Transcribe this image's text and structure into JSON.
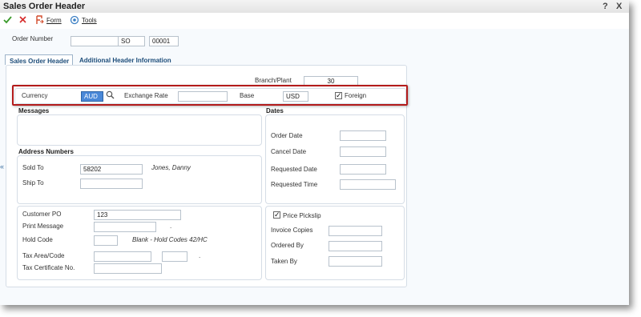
{
  "window": {
    "title": "Sales Order Header",
    "help": "?",
    "close": "X"
  },
  "toolbar": {
    "form_label": "Form",
    "tools_label": "Tools"
  },
  "order": {
    "label": "Order Number",
    "number": "",
    "type": "SO",
    "company": "00001"
  },
  "tabs": [
    "Sales Order Header",
    "Additional Header Information"
  ],
  "branch": {
    "label": "Branch/Plant",
    "value": "30"
  },
  "currency": {
    "label": "Currency",
    "value": "AUD",
    "rate_label": "Exchange Rate",
    "rate_value": "",
    "base_label": "Base",
    "base_value": "USD",
    "foreign_label": "Foreign"
  },
  "messages": {
    "title": "Messages"
  },
  "dates": {
    "title": "Dates",
    "order_date": "Order Date",
    "cancel_date": "Cancel Date",
    "requested_date": "Requested Date",
    "requested_time": "Requested Time"
  },
  "address": {
    "title": "Address Numbers",
    "sold_to_label": "Sold To",
    "sold_to_value": "58202",
    "sold_to_name": "Jones, Danny",
    "ship_to_label": "Ship To"
  },
  "po": {
    "label": "Customer PO",
    "value": "123",
    "print_label": "Print Message",
    "dot": ".",
    "hold_label": "Hold Code",
    "hold_desc": "Blank - Hold Codes 42/HC",
    "tax_area_label": "Tax Area/Code",
    "tax_cert_label": "Tax Certificate No."
  },
  "pickslip": {
    "label": "Price Pickslip",
    "invoice_copies": "Invoice Copies",
    "ordered_by": "Ordered By",
    "taken_by": "Taken By"
  },
  "side_toggle": "«"
}
